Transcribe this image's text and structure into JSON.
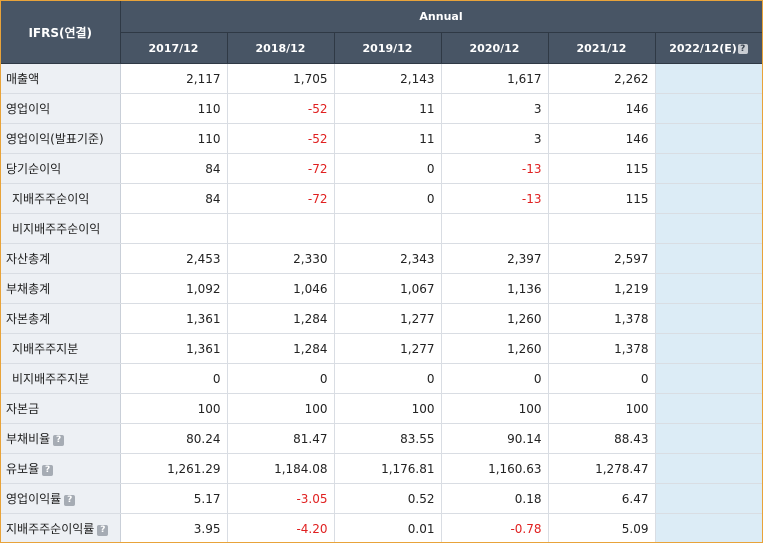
{
  "header": {
    "corner_label": "IFRS(연결)",
    "group_label": "Annual",
    "periods": [
      "2017/12",
      "2018/12",
      "2019/12",
      "2020/12",
      "2021/12",
      "2022/12(E)"
    ],
    "estimate_help_icon": "question-mark-icon"
  },
  "rows": [
    {
      "label": "매출액",
      "values": [
        "2,117",
        "1,705",
        "2,143",
        "1,617",
        "2,262",
        ""
      ]
    },
    {
      "label": "영업이익",
      "values": [
        "110",
        "-52",
        "11",
        "3",
        "146",
        ""
      ]
    },
    {
      "label": "영업이익(발표기준)",
      "values": [
        "110",
        "-52",
        "11",
        "3",
        "146",
        ""
      ]
    },
    {
      "label": "당기순이익",
      "values": [
        "84",
        "-72",
        "0",
        "-13",
        "115",
        ""
      ]
    },
    {
      "label": "지배주주순이익",
      "values": [
        "84",
        "-72",
        "0",
        "-13",
        "115",
        ""
      ]
    },
    {
      "label": "비지배주주순이익",
      "values": [
        "",
        "",
        "",
        "",
        "",
        ""
      ]
    },
    {
      "label": "자산총계",
      "values": [
        "2,453",
        "2,330",
        "2,343",
        "2,397",
        "2,597",
        ""
      ]
    },
    {
      "label": "부채총계",
      "values": [
        "1,092",
        "1,046",
        "1,067",
        "1,136",
        "1,219",
        ""
      ]
    },
    {
      "label": "자본총계",
      "values": [
        "1,361",
        "1,284",
        "1,277",
        "1,260",
        "1,378",
        ""
      ]
    },
    {
      "label": "지배주주지분",
      "values": [
        "1,361",
        "1,284",
        "1,277",
        "1,260",
        "1,378",
        ""
      ]
    },
    {
      "label": "비지배주주지분",
      "values": [
        "0",
        "0",
        "0",
        "0",
        "0",
        ""
      ]
    },
    {
      "label": "자본금",
      "values": [
        "100",
        "100",
        "100",
        "100",
        "100",
        ""
      ]
    },
    {
      "label": "부채비율",
      "values": [
        "80.24",
        "81.47",
        "83.55",
        "90.14",
        "88.43",
        ""
      ]
    },
    {
      "label": "유보율",
      "values": [
        "1,261.29",
        "1,184.08",
        "1,176.81",
        "1,160.63",
        "1,278.47",
        ""
      ]
    },
    {
      "label": "영업이익률",
      "values": [
        "5.17",
        "-3.05",
        "0.52",
        "0.18",
        "6.47",
        ""
      ]
    },
    {
      "label": "지배주주순이익률",
      "values": [
        "3.95",
        "-4.20",
        "0.01",
        "-0.78",
        "5.09",
        ""
      ]
    }
  ],
  "colors": {
    "header_bg": "#485565",
    "label_bg": "#edf0f4",
    "estimate_bg": "#dcecf6",
    "negative": "#e02020",
    "border_accent": "#e8a33a"
  }
}
